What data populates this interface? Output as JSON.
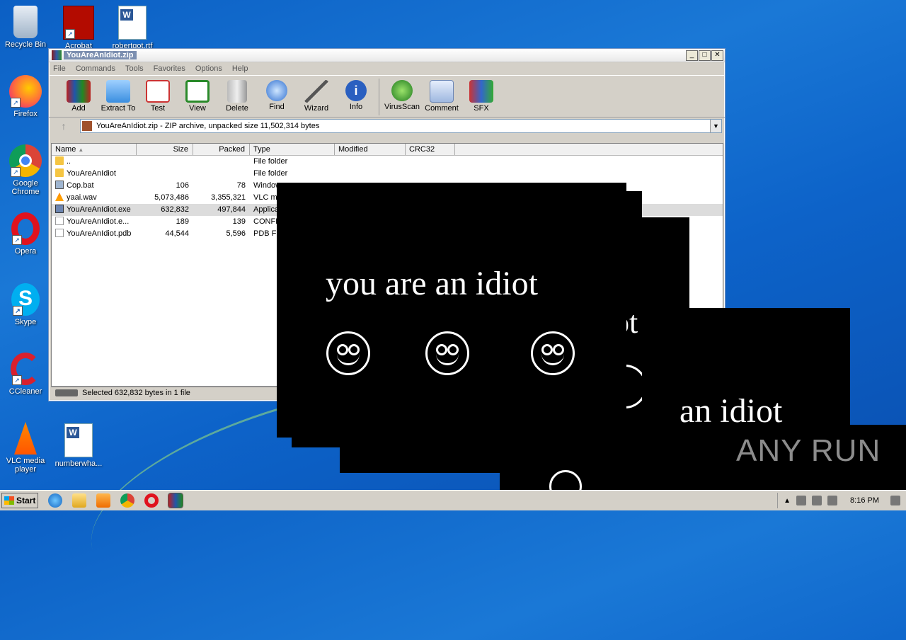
{
  "desktop": {
    "icons": [
      {
        "label": "Recycle Bin"
      },
      {
        "label": "Acrobat"
      },
      {
        "label": "robertgot.rtf"
      },
      {
        "label": "Firefox"
      },
      {
        "label": "Google Chrome"
      },
      {
        "label": "Opera"
      },
      {
        "label": "Skype"
      },
      {
        "label": "CCleaner"
      },
      {
        "label": "VLC media player"
      },
      {
        "label": "numberwha..."
      }
    ]
  },
  "winrar": {
    "title": "YouAreAnIdiot.zip",
    "menu": [
      "File",
      "Commands",
      "Tools",
      "Favorites",
      "Options",
      "Help"
    ],
    "toolbar": [
      "Add",
      "Extract To",
      "Test",
      "View",
      "Delete",
      "Find",
      "Wizard",
      "Info",
      "VirusScan",
      "Comment",
      "SFX"
    ],
    "address": "YouAreAnIdiot.zip - ZIP archive, unpacked size 11,502,314 bytes",
    "columns": [
      "Name",
      "Size",
      "Packed",
      "Type",
      "Modified",
      "CRC32"
    ],
    "rows": [
      {
        "name": "..",
        "size": "",
        "packed": "",
        "type": "File folder"
      },
      {
        "name": "YouAreAnIdiot",
        "size": "",
        "packed": "",
        "type": "File folder"
      },
      {
        "name": "Cop.bat",
        "size": "106",
        "packed": "78",
        "type": "Window"
      },
      {
        "name": "yaai.wav",
        "size": "5,073,486",
        "packed": "3,355,321",
        "type": "VLC me"
      },
      {
        "name": "YouAreAnIdiot.exe",
        "size": "632,832",
        "packed": "497,844",
        "type": "Applica"
      },
      {
        "name": "YouAreAnIdiot.e...",
        "size": "189",
        "packed": "139",
        "type": "CONFIG"
      },
      {
        "name": "YouAreAnIdiot.pdb",
        "size": "44,544",
        "packed": "5,596",
        "type": "PDB File"
      }
    ],
    "status": "Selected 632,832 bytes in 1 file"
  },
  "popup": {
    "text": "you are an idiot",
    "partial_text_a": "ot",
    "partial_text_b": "an idiot"
  },
  "taskbar": {
    "start": "Start",
    "time": "8:16 PM"
  },
  "watermark": "ANY RUN"
}
